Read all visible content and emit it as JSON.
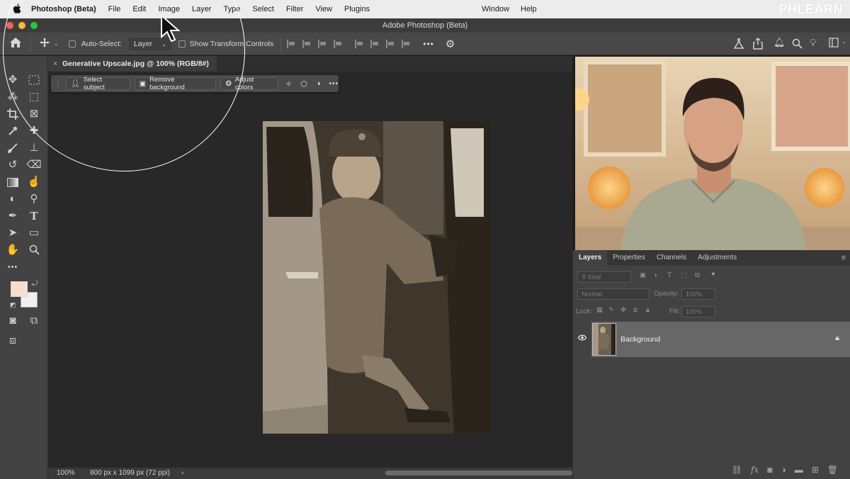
{
  "menubar": {
    "apple": "",
    "app_name": "Photoshop (Beta)",
    "items": [
      "File",
      "Edit",
      "Image",
      "Layer",
      "Type",
      "Select",
      "Filter",
      "View",
      "Plugins"
    ],
    "right_items": [
      "Window",
      "Help"
    ],
    "watermark": "PHLEARN"
  },
  "window": {
    "title": "Adobe Photoshop (Beta)"
  },
  "options_bar": {
    "auto_select_label": "Auto-Select:",
    "auto_select_value": "Layer",
    "show_transform_label": "Show Transform Controls",
    "more": "•••"
  },
  "document": {
    "tab_title": "Generative Upscale.jpg @ 100% (RGB/8#)",
    "close": "×"
  },
  "contextual_taskbar": {
    "select_subject": "Select subject",
    "remove_background": "Remove background",
    "adjust_colors": "Adjust colors",
    "more": "•••"
  },
  "status_bar": {
    "zoom": "100%",
    "doc_info": "800 px x 1099 px (72 ppi)",
    "arrow": "›"
  },
  "layers_panel": {
    "tabs": [
      "Layers",
      "Properties",
      "Channels",
      "Adjustments"
    ],
    "filter_kind": "Kind",
    "blend_mode": "Normal",
    "opacity_label": "Opacity:",
    "opacity_value": "100%",
    "lock_label": "Lock:",
    "fill_label": "Fill:",
    "fill_value": "100%",
    "layers": [
      {
        "name": "Background",
        "locked": true,
        "visible": true
      }
    ]
  },
  "toolbar": {
    "more": "•••"
  },
  "colors": {
    "foreground": "#f7ddd0",
    "background": "#f0f0f0",
    "accent": "#ffffff"
  }
}
